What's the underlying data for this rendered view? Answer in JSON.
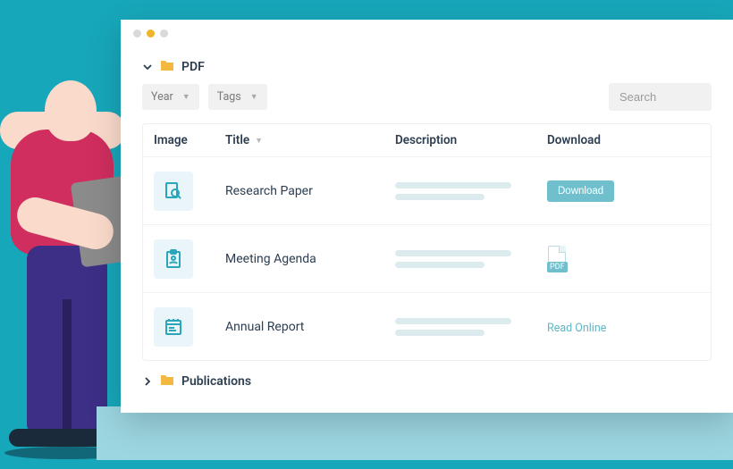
{
  "folders": [
    {
      "name": "PDF",
      "expanded": true
    },
    {
      "name": "Publications",
      "expanded": false
    }
  ],
  "filters": {
    "year_label": "Year",
    "tags_label": "Tags"
  },
  "search": {
    "placeholder": "Search"
  },
  "columns": {
    "image": "Image",
    "title": "Title",
    "description": "Description",
    "download": "Download"
  },
  "rows": [
    {
      "icon": "doc-search-icon",
      "title": "Research Paper",
      "action": {
        "kind": "button",
        "label": "Download"
      }
    },
    {
      "icon": "clipboard-user-icon",
      "title": "Meeting Agenda",
      "action": {
        "kind": "pdf-badge",
        "label": "PDF"
      }
    },
    {
      "icon": "calendar-notes-icon",
      "title": "Annual Report",
      "action": {
        "kind": "link",
        "label": "Read Online"
      }
    }
  ],
  "colors": {
    "teal": "#17a7ba",
    "accent": "#6fc0cc"
  }
}
